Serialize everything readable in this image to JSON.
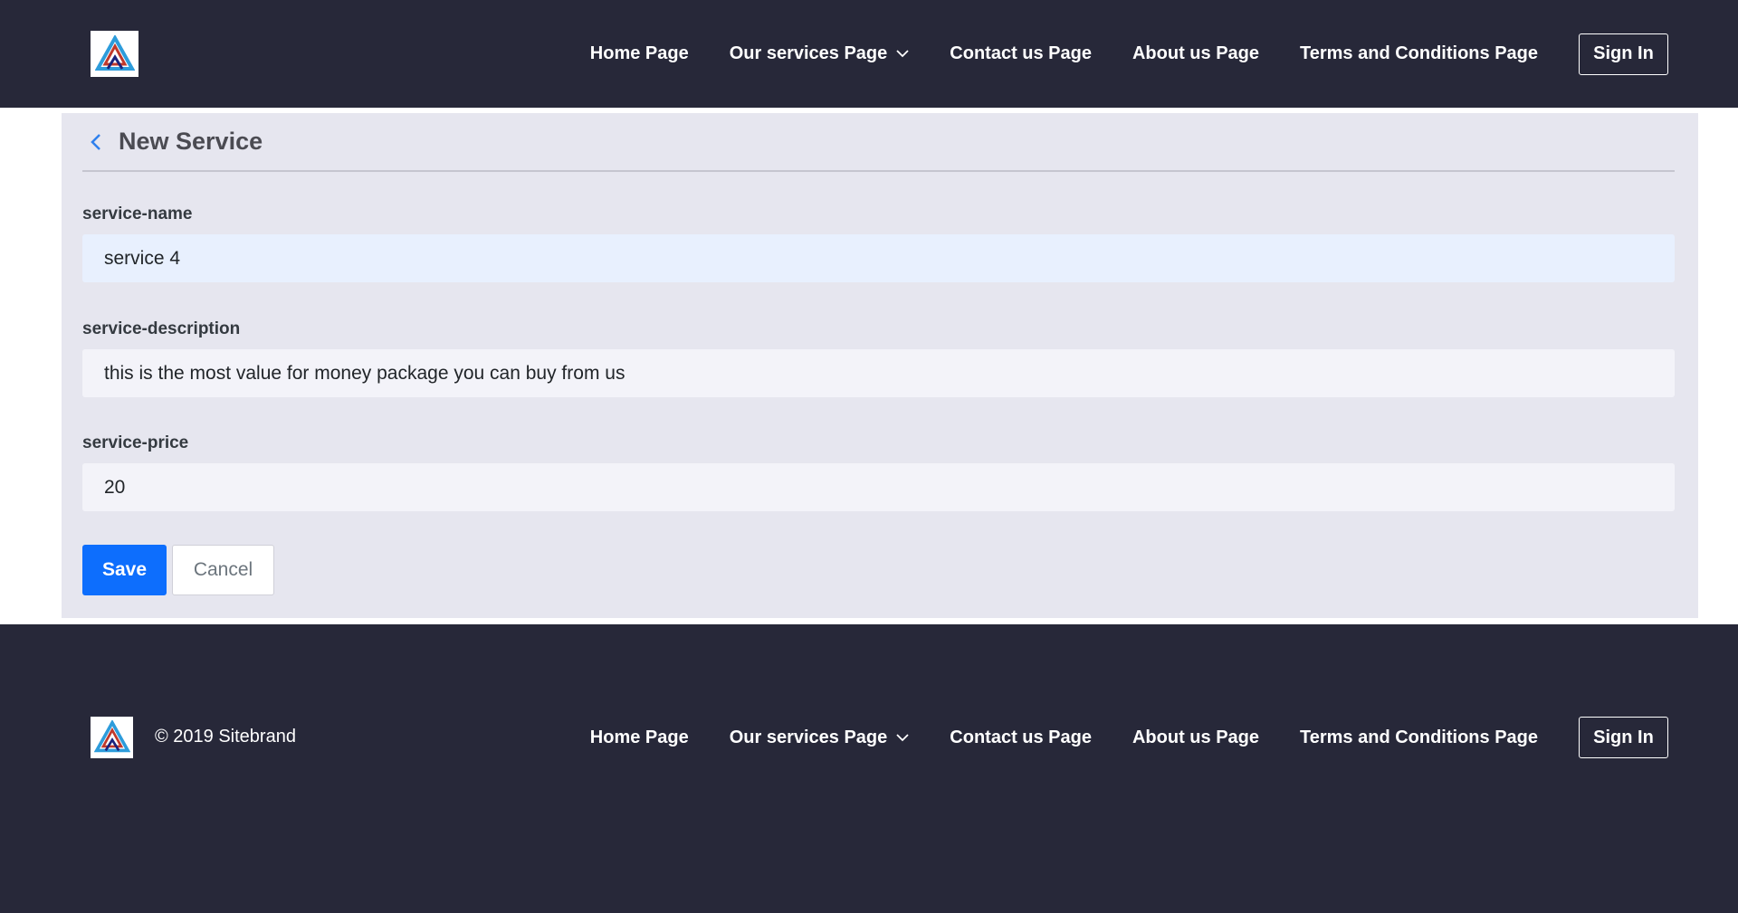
{
  "header": {
    "nav": [
      {
        "label": "Home Page"
      },
      {
        "label": "Our services Page",
        "has_dropdown": true
      },
      {
        "label": "Contact us Page"
      },
      {
        "label": "About us Page"
      },
      {
        "label": "Terms and Conditions Page"
      }
    ],
    "sign_in_label": "Sign In"
  },
  "form": {
    "title": "New Service",
    "fields": [
      {
        "label": "service-name",
        "value": "service 4"
      },
      {
        "label": "service-description",
        "value": "this is the most value for money package you can buy from us"
      },
      {
        "label": "service-price",
        "value": "20"
      }
    ],
    "save_label": "Save",
    "cancel_label": "Cancel"
  },
  "footer": {
    "copyright": "© 2019 Sitebrand",
    "nav": [
      {
        "label": "Home Page"
      },
      {
        "label": "Our services Page",
        "has_dropdown": true
      },
      {
        "label": "Contact us Page"
      },
      {
        "label": "About us Page"
      },
      {
        "label": "Terms and Conditions Page"
      }
    ],
    "sign_in_label": "Sign In"
  },
  "colors": {
    "nav_bg": "#272839",
    "panel_bg": "#e6e6ef",
    "primary": "#0d6efd",
    "back_arrow": "#2f80ed"
  }
}
